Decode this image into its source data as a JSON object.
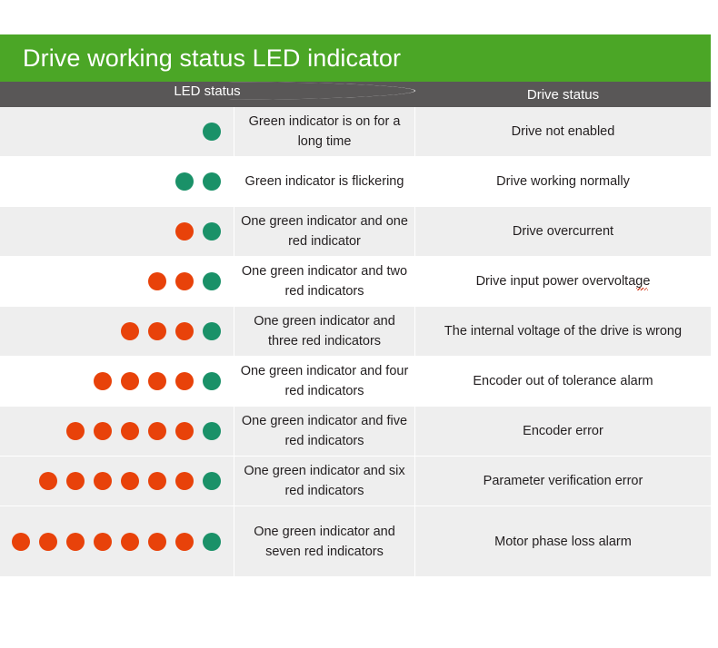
{
  "banner": {
    "title": "Drive working status LED indicator",
    "background_color": "#4ba626",
    "text_color": "#ffffff"
  },
  "table": {
    "header_background": "#595757",
    "row_shade_gray": "#eeeeee",
    "row_shade_white": "#ffffff",
    "led_green_color": "#1a9168",
    "led_red_color": "#e8420a",
    "columns": [
      {
        "key": "led_status",
        "label": "LED status"
      },
      {
        "key": "drive_status",
        "label": "Drive status"
      }
    ],
    "rows": [
      {
        "green": 1,
        "red": 0,
        "led_description": "Green indicator is on for a long time",
        "drive_status": "Drive not enabled",
        "shade": "gray"
      },
      {
        "green": 2,
        "red": 0,
        "led_description": "Green indicator is flickering",
        "drive_status": "Drive working normally",
        "shade": "white"
      },
      {
        "green": 1,
        "red": 1,
        "led_description": "One green indicator and one red indicator",
        "drive_status": "Drive overcurrent",
        "shade": "gray"
      },
      {
        "green": 1,
        "red": 2,
        "led_description": "One green indicator and two red indicators",
        "drive_status": "Drive input power overvoltage",
        "shade": "white",
        "spellcheck_underline": true
      },
      {
        "green": 1,
        "red": 3,
        "led_description": "One green indicator and three red indicators",
        "drive_status": "The internal voltage of the drive is wrong",
        "shade": "gray"
      },
      {
        "green": 1,
        "red": 4,
        "led_description": "One green indicator and four red indicators",
        "drive_status": "Encoder out of tolerance alarm",
        "shade": "white"
      },
      {
        "green": 1,
        "red": 5,
        "led_description": "One green indicator and five red indicators",
        "drive_status": "Encoder error",
        "shade": "gray"
      },
      {
        "green": 1,
        "red": 6,
        "led_description": "One green indicator and six red indicators",
        "drive_status": "Parameter verification error",
        "shade": "gray"
      },
      {
        "green": 1,
        "red": 7,
        "led_description": "One green indicator and seven red indicators",
        "drive_status": "Motor phase loss alarm",
        "shade": "gray"
      }
    ]
  }
}
